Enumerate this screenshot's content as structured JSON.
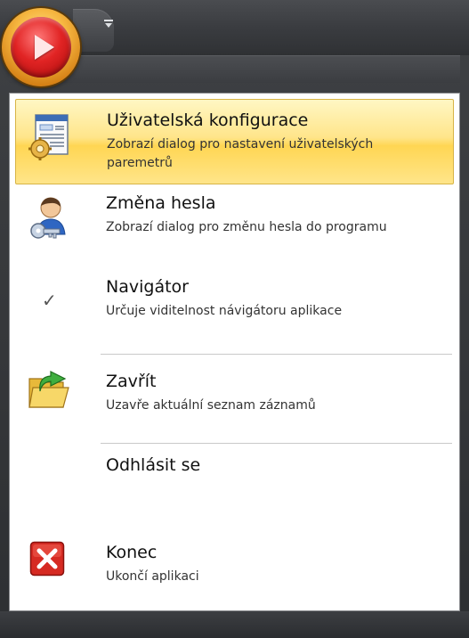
{
  "menu": {
    "items": [
      {
        "title": "Uživatelská konfigurace",
        "desc": "Zobrazí dialog pro nastavení uživatelských paremetrů",
        "icon": "config-document-icon"
      },
      {
        "title": "Změna hesla",
        "desc": "Zobrazí dialog pro změnu hesla do programu",
        "icon": "user-key-icon"
      },
      {
        "title": "Navigátor",
        "desc": "Určuje viditelnost návigátoru aplikace",
        "icon": "checkmark-icon"
      },
      {
        "title": "Zavřít",
        "desc": "Uzavře aktuální seznam záznamů",
        "icon": "open-folder-icon"
      },
      {
        "title": "Odhlásit se",
        "desc": "",
        "icon": ""
      },
      {
        "title": "Konec",
        "desc": "Ukončí aplikaci",
        "icon": "close-x-icon"
      }
    ],
    "check_glyph": "✓"
  },
  "colors": {
    "highlight": "#ffe58a",
    "app_button_red": "#e12424",
    "app_button_ring": "#f6b640",
    "frame": "#3a3c40"
  }
}
